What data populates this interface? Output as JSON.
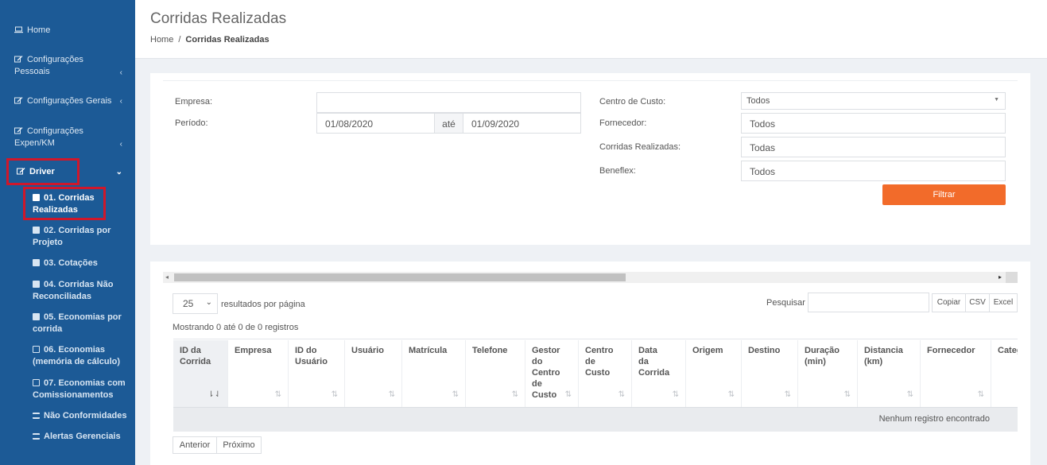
{
  "sidebar": {
    "home": "Home",
    "config_pessoais_1": "Configurações",
    "config_pessoais_2": "Pessoais",
    "config_gerais": "Configurações Gerais",
    "config_expen_1": "Configurações",
    "config_expen_2": "Expen/KM",
    "driver": "Driver",
    "sub_items": [
      {
        "l1": "01. Corridas",
        "l2": "Realizadas"
      },
      {
        "l1": "02. Corridas por",
        "l2": "Projeto"
      },
      {
        "l1": "03. Cotações",
        "l2": ""
      },
      {
        "l1": "04. Corridas Não",
        "l2": "Reconciliadas"
      },
      {
        "l1": "05. Economias por",
        "l2": "corrida"
      },
      {
        "l1": "06. Economias",
        "l2": "(memória de cálculo)"
      },
      {
        "l1": "07. Economias com",
        "l2": "Comissionamentos"
      },
      {
        "l1": "Não Conformidades",
        "l2": ""
      },
      {
        "l1": "Alertas Gerenciais",
        "l2": ""
      }
    ]
  },
  "header": {
    "title": "Corridas Realizadas",
    "breadcrumb_home": "Home",
    "breadcrumb_sep": "/",
    "breadcrumb_current": "Corridas Realizadas"
  },
  "filters": {
    "empresa_label": "Empresa:",
    "empresa_value": "",
    "periodo_label": "Período:",
    "periodo_start": "01/08/2020",
    "periodo_ate": "até",
    "periodo_end": "01/09/2020",
    "centro_label": "Centro de Custo:",
    "centro_value": "Todos",
    "fornecedor_label": "Fornecedor:",
    "fornecedor_value": "Todos",
    "corridas_label": "Corridas Realizadas:",
    "corridas_value": "Todas",
    "beneflex_label": "Beneflex:",
    "beneflex_value": "Todos",
    "filtrar": "Filtrar"
  },
  "table": {
    "page_size": "25",
    "page_size_label": "resultados por página",
    "search_label": "Pesquisar",
    "btn_copiar": "Copiar",
    "btn_csv": "CSV",
    "btn_excel": "Excel",
    "info": "Mostrando 0 até 0 de 0 registros",
    "columns": [
      "ID da Corrida",
      "Empresa",
      "ID do Usuário",
      "Usuário",
      "Matrícula",
      "Telefone",
      "Gestor do Centro de Custo",
      "Centro de Custo",
      "Data da Corrida",
      "Origem",
      "Destino",
      "Duração (min)",
      "Distancia (km)",
      "Fornecedor",
      "Categ"
    ],
    "empty": "Nenhum registro encontrado",
    "prev": "Anterior",
    "next": "Próximo"
  },
  "colors": {
    "sidebar_bg": "#1c5a96",
    "highlight": "#d0172a",
    "accent_button": "#f26b2a"
  }
}
